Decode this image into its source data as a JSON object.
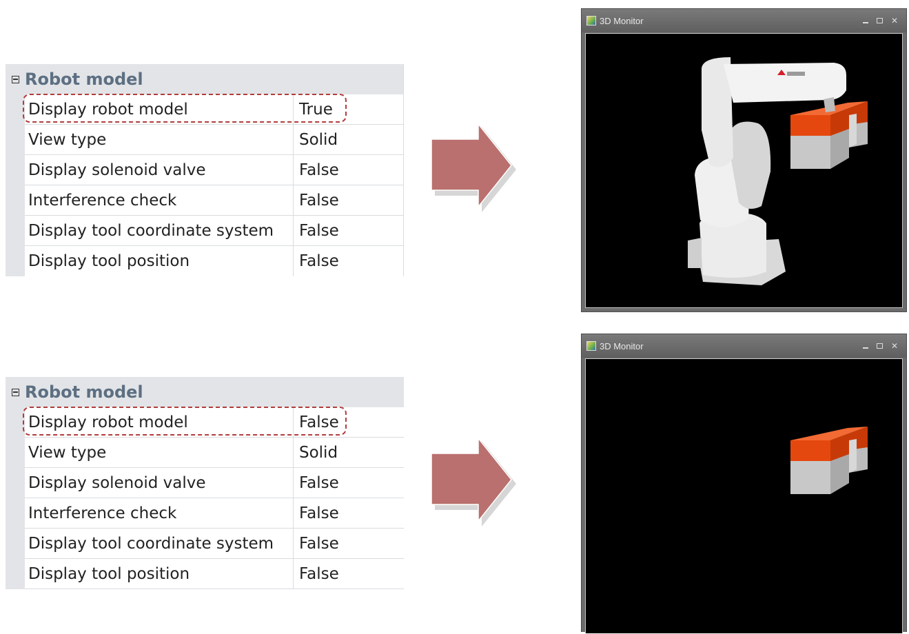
{
  "panels": [
    {
      "section_title": "Robot model",
      "rows": [
        {
          "name": "Display robot model",
          "value": "True"
        },
        {
          "name": "View type",
          "value": "Solid"
        },
        {
          "name": "Display solenoid valve",
          "value": "False"
        },
        {
          "name": "Interference check",
          "value": "False"
        },
        {
          "name": "Display tool coordinate system",
          "value": "False"
        },
        {
          "name": "Display tool position",
          "value": "False"
        }
      ],
      "monitor": {
        "title": "3D Monitor",
        "shows_robot": true
      }
    },
    {
      "section_title": "Robot model",
      "rows": [
        {
          "name": "Display robot model",
          "value": "False"
        },
        {
          "name": "View type",
          "value": "Solid"
        },
        {
          "name": "Display solenoid valve",
          "value": "False"
        },
        {
          "name": "Interference check",
          "value": "False"
        },
        {
          "name": "Display tool coordinate system",
          "value": "False"
        },
        {
          "name": "Display tool position",
          "value": "False"
        }
      ],
      "monitor": {
        "title": "3D Monitor",
        "shows_robot": false
      }
    }
  ],
  "colors": {
    "highlight_dash": "#b23b3b",
    "arrow_fill": "#b9706e",
    "workpiece_top": "#e5480e",
    "workpiece_base": "#c8c8c8"
  },
  "icons": [
    "collapse-icon",
    "app-icon",
    "minimize-icon",
    "maximize-icon",
    "close-icon",
    "right-arrow-icon"
  ]
}
